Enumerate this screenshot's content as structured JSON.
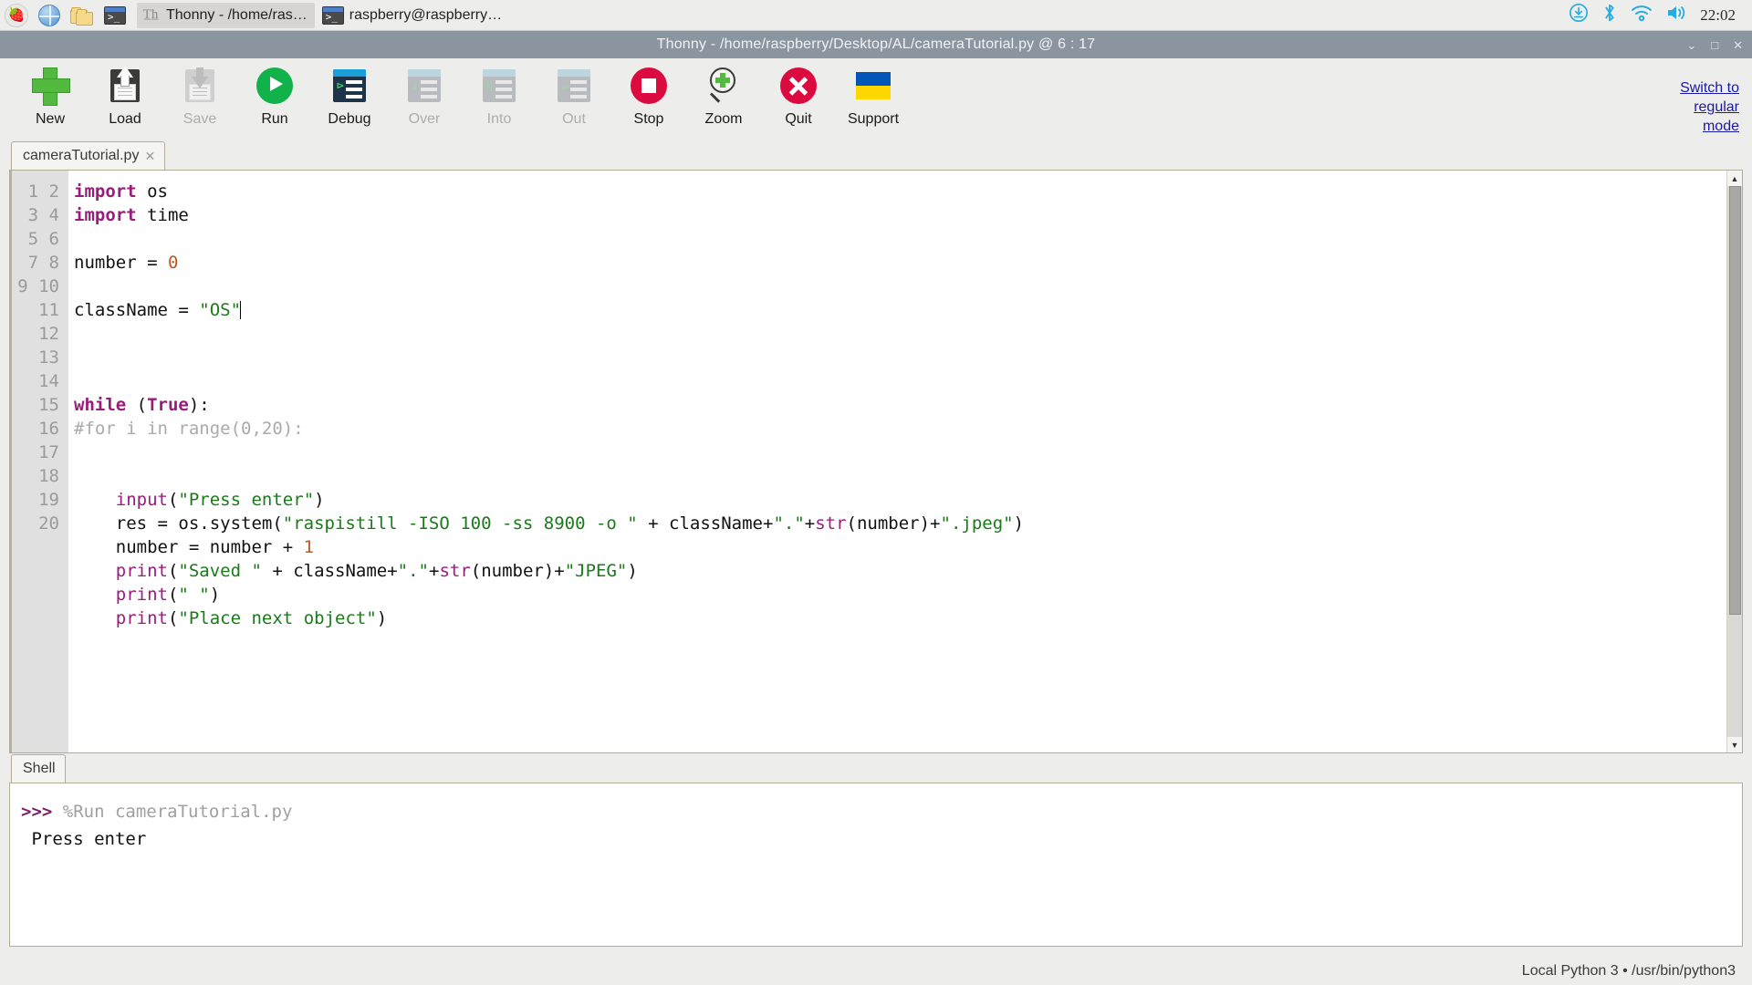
{
  "taskbar": {
    "launchers": [
      {
        "name": "raspberry-menu-icon",
        "glyph": "●"
      },
      {
        "name": "web-browser-icon",
        "glyph": ""
      },
      {
        "name": "file-manager-icon",
        "glyph": ""
      },
      {
        "name": "terminal-icon",
        "glyph": ">_"
      }
    ],
    "windows": [
      {
        "label": "Thonny  -  /home/ras…",
        "icon": "thonny-icon",
        "active": true
      },
      {
        "label": "raspberry@raspberry…",
        "icon": "terminal-icon",
        "active": false
      }
    ],
    "tray": [
      {
        "name": "updates-icon"
      },
      {
        "name": "bluetooth-icon"
      },
      {
        "name": "wifi-icon"
      },
      {
        "name": "volume-icon"
      }
    ],
    "clock": "22:02"
  },
  "window": {
    "title": "Thonny  -  /home/raspberry/Desktop/AL/cameraTutorial.py  @  6 : 17",
    "controls": {
      "minimize": "⌄",
      "maximize": "□",
      "close": "✕"
    }
  },
  "toolbar": {
    "buttons": [
      {
        "label": "New",
        "icon": "new-file-icon",
        "enabled": true
      },
      {
        "label": "Load",
        "icon": "load-file-icon",
        "enabled": true
      },
      {
        "label": "Save",
        "icon": "save-file-icon",
        "enabled": false
      },
      {
        "label": "Run",
        "icon": "run-icon",
        "enabled": true
      },
      {
        "label": "Debug",
        "icon": "debug-icon",
        "enabled": true
      },
      {
        "label": "Over",
        "icon": "step-over-icon",
        "enabled": false
      },
      {
        "label": "Into",
        "icon": "step-into-icon",
        "enabled": false
      },
      {
        "label": "Out",
        "icon": "step-out-icon",
        "enabled": false
      },
      {
        "label": "Stop",
        "icon": "stop-icon",
        "enabled": true
      },
      {
        "label": "Zoom",
        "icon": "zoom-icon",
        "enabled": true
      },
      {
        "label": "Quit",
        "icon": "quit-icon",
        "enabled": true
      },
      {
        "label": "Support",
        "icon": "ukraine-flag-icon",
        "enabled": true
      }
    ],
    "switch_mode": [
      "Switch to",
      "regular",
      "mode"
    ]
  },
  "editor": {
    "tab": {
      "label": "cameraTutorial.py",
      "close": "✕"
    },
    "cursor": {
      "line": 6,
      "column": 17
    },
    "line_numbers": [
      1,
      2,
      3,
      4,
      5,
      6,
      7,
      8,
      9,
      10,
      11,
      12,
      13,
      14,
      15,
      16,
      17,
      18,
      19,
      20
    ],
    "lines": [
      {
        "n": 1,
        "text": "import os"
      },
      {
        "n": 2,
        "text": "import time"
      },
      {
        "n": 3,
        "text": ""
      },
      {
        "n": 4,
        "text": "number = 0"
      },
      {
        "n": 5,
        "text": ""
      },
      {
        "n": 6,
        "text": "className = \"OS\""
      },
      {
        "n": 7,
        "text": ""
      },
      {
        "n": 8,
        "text": ""
      },
      {
        "n": 9,
        "text": ""
      },
      {
        "n": 10,
        "text": "while (True):"
      },
      {
        "n": 11,
        "text": "#for i in range(0,20):"
      },
      {
        "n": 12,
        "text": ""
      },
      {
        "n": 13,
        "text": ""
      },
      {
        "n": 14,
        "text": "    input(\"Press enter\")"
      },
      {
        "n": 15,
        "text": "    res = os.system(\"raspistill -ISO 100 -ss 8900 -o \" + className+\".\"+str(number)+\".jpeg\")"
      },
      {
        "n": 16,
        "text": "    number = number + 1"
      },
      {
        "n": 17,
        "text": "    print(\"Saved \" + className+\".\"+str(number)+\"JPEG\")"
      },
      {
        "n": 18,
        "text": "    print(\" \")"
      },
      {
        "n": 19,
        "text": "    print(\"Place next object\")"
      },
      {
        "n": 20,
        "text": ""
      }
    ]
  },
  "shell": {
    "tab_label": "Shell",
    "prompt": ">>>",
    "command": "%Run cameraTutorial.py",
    "output": " Press enter"
  },
  "statusbar": {
    "interpreter": "Local Python 3  •  /usr/bin/python3"
  },
  "colors": {
    "titlebar": "#8b95a0",
    "chrome": "#ededeb",
    "keyword": "#9b1b7a",
    "string": "#1a7a1a",
    "number": "#c1571b",
    "comment": "#aaaaaa",
    "link": "#1a1aa8",
    "run_green": "#11b24a",
    "stop_red": "#dc0b3f"
  }
}
